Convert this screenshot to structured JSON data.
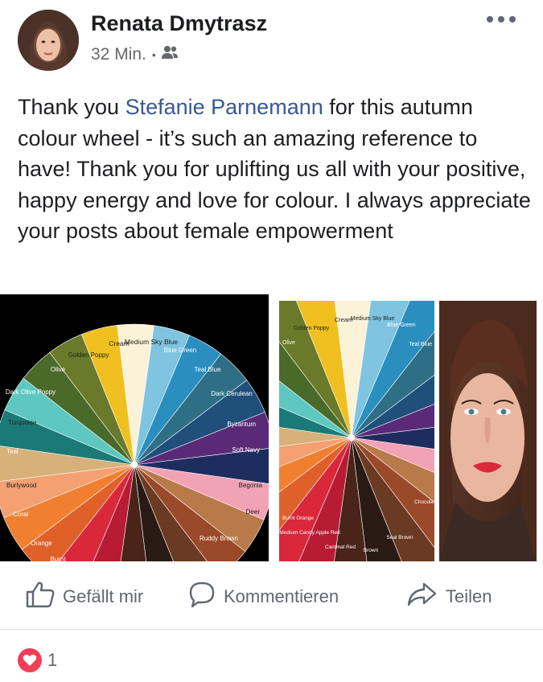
{
  "post": {
    "author": "Renata Dmytrasz",
    "time": "32 Min.",
    "separator": "•",
    "audience_icon": "friends-icon",
    "more_icon": "more-options-icon",
    "text_before": "Thank you ",
    "mention": "Stefanie Parnemann",
    "text_after": " for this autumn colour wheel - it’s such an amazing reference to have! Thank you for uplifting us all with your positive, happy energy and love for colour.  I always appreciate your posts about female empowerment"
  },
  "media": {
    "wheel_full_labels": [
      "Cream",
      "Medium Sky Blue",
      "Blue Green",
      "Teal Blue",
      "Dark Cerulean",
      "Byzantum",
      "Soft Navy",
      "Begonia",
      "Deer",
      "Ruddy Brown",
      "Burnt",
      "Orange",
      "Coral",
      "Burlywood",
      "Teal",
      "Turquoise",
      "Dark Olive Poppy",
      "Olive",
      "Golden Poppy"
    ],
    "wheel_crop_labels": [
      "Cream",
      "Medium Sky Blue",
      "Blue Green",
      "Teal Blue",
      "Golden Poppy",
      "Olive",
      "Burnt Orange",
      "Medium Candy Apple Red",
      "Cardinal Red",
      "Brown",
      "Seal Brown",
      "Chocola"
    ]
  },
  "actions": {
    "like": "Gefällt mir",
    "comment": "Kommentieren",
    "share": "Teilen"
  },
  "reactions": {
    "count": "1"
  },
  "colors": {
    "mention": "#385898",
    "text": "#1c1e21",
    "muted": "#65676b",
    "heart": "#f33e58"
  }
}
